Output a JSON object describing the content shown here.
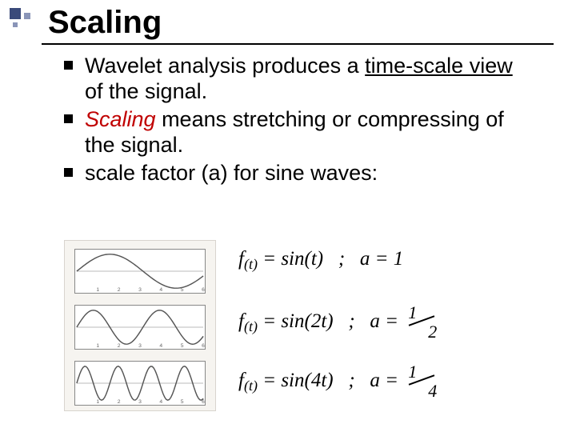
{
  "title": "Scaling",
  "bullets": {
    "b1_pre": "Wavelet analysis produces a ",
    "b1_ul": "time-scale view",
    "b1_post": " of the signal.",
    "b2_em": "Scaling",
    "b2_post": " means stretching or compressing of the signal.",
    "b3": "scale factor (a) for sine waves:"
  },
  "equations": {
    "row1": {
      "f": "f",
      "arg": "(t)",
      "eq": " = sin(t)   ;   a = 1"
    },
    "row2": {
      "f": "f",
      "arg": "(t)",
      "eq_left": " = sin(2t)   ;   a = ",
      "frac_num": "1",
      "frac_den": "2"
    },
    "row3": {
      "f": "f",
      "arg": "(t)",
      "eq_left": " = sin(4t)   ;   a = ",
      "frac_num": "1",
      "frac_den": "4"
    }
  },
  "chart_data": [
    {
      "type": "line",
      "title": "",
      "xlabel": "",
      "ylabel": "",
      "xlim": [
        0,
        6
      ],
      "ylim": [
        -1,
        1
      ],
      "series": [
        {
          "name": "sin(t)",
          "expr": "sin(x)",
          "freq": 1
        }
      ]
    },
    {
      "type": "line",
      "title": "",
      "xlabel": "",
      "ylabel": "",
      "xlim": [
        0,
        6
      ],
      "ylim": [
        -1,
        1
      ],
      "series": [
        {
          "name": "sin(2t)",
          "expr": "sin(2x)",
          "freq": 2
        }
      ]
    },
    {
      "type": "line",
      "title": "",
      "xlabel": "",
      "ylabel": "",
      "xlim": [
        0,
        6
      ],
      "ylim": [
        -1,
        1
      ],
      "series": [
        {
          "name": "sin(4t)",
          "expr": "sin(4x)",
          "freq": 4
        }
      ]
    }
  ],
  "tick_labels": [
    "1",
    "2",
    "3",
    "4",
    "5",
    "6"
  ]
}
